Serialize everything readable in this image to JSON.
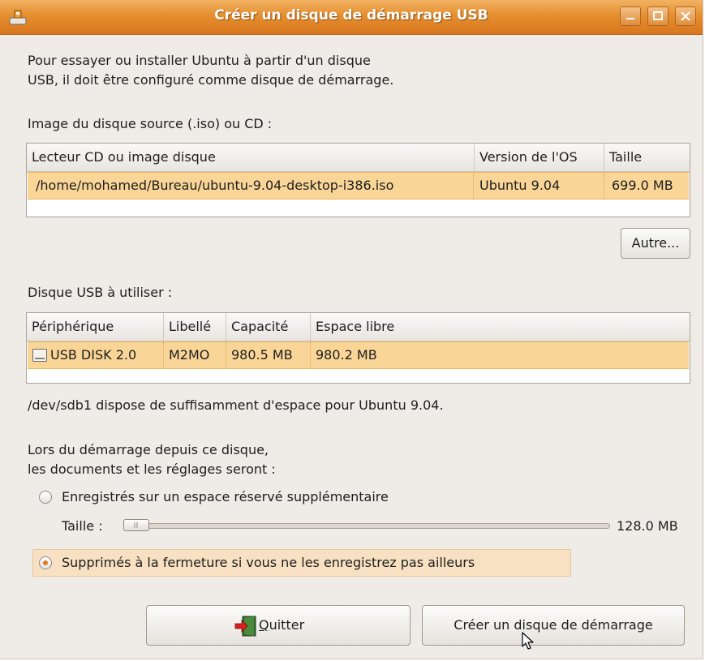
{
  "window": {
    "title": "Créer un disque de démarrage USB"
  },
  "intro": {
    "line1": "Pour essayer ou installer Ubuntu à partir d'un disque",
    "line2": "USB, il doit être configuré comme disque de démarrage."
  },
  "source": {
    "label": "Image du disque source (.iso) ou CD :",
    "columns": [
      "Lecteur CD ou image disque",
      "Version de l'OS",
      "Taille"
    ],
    "rows": [
      {
        "path": "/home/mohamed/Bureau/ubuntu-9.04-desktop-i386.iso",
        "version": "Ubuntu 9.04",
        "size": "699.0 MB"
      }
    ],
    "other_button": "Autre..."
  },
  "usb": {
    "label": "Disque USB à utiliser :",
    "columns": [
      "Périphérique",
      "Libellé",
      "Capacité",
      "Espace libre"
    ],
    "rows": [
      {
        "device": "USB DISK 2.0",
        "label": "M2MO",
        "capacity": "980.5 MB",
        "free": "980.2 MB"
      }
    ]
  },
  "status": "/dev/sdb1 dispose de suffisamment d'espace pour Ubuntu 9.04.",
  "persistence": {
    "intro1": "Lors du démarrage depuis ce disque,",
    "intro2": "les documents et les réglages seront :",
    "option_save": "Enregistrés sur un espace réservé supplémentaire",
    "size_label": "Taille :",
    "size_value": "128.0 MB",
    "slider_fraction": 0.0,
    "option_discard": "Supprimés à la fermeture si vous ne les enregistrez pas ailleurs",
    "selected": "discard"
  },
  "buttons": {
    "quit_prefix": "",
    "quit_mnemonic": "Q",
    "quit_rest": "uitter",
    "create": "Créer un disque de démarrage"
  },
  "colors": {
    "accent": "#e58f2f",
    "selection": "#f9d597",
    "radio_dot": "#e07a24"
  }
}
